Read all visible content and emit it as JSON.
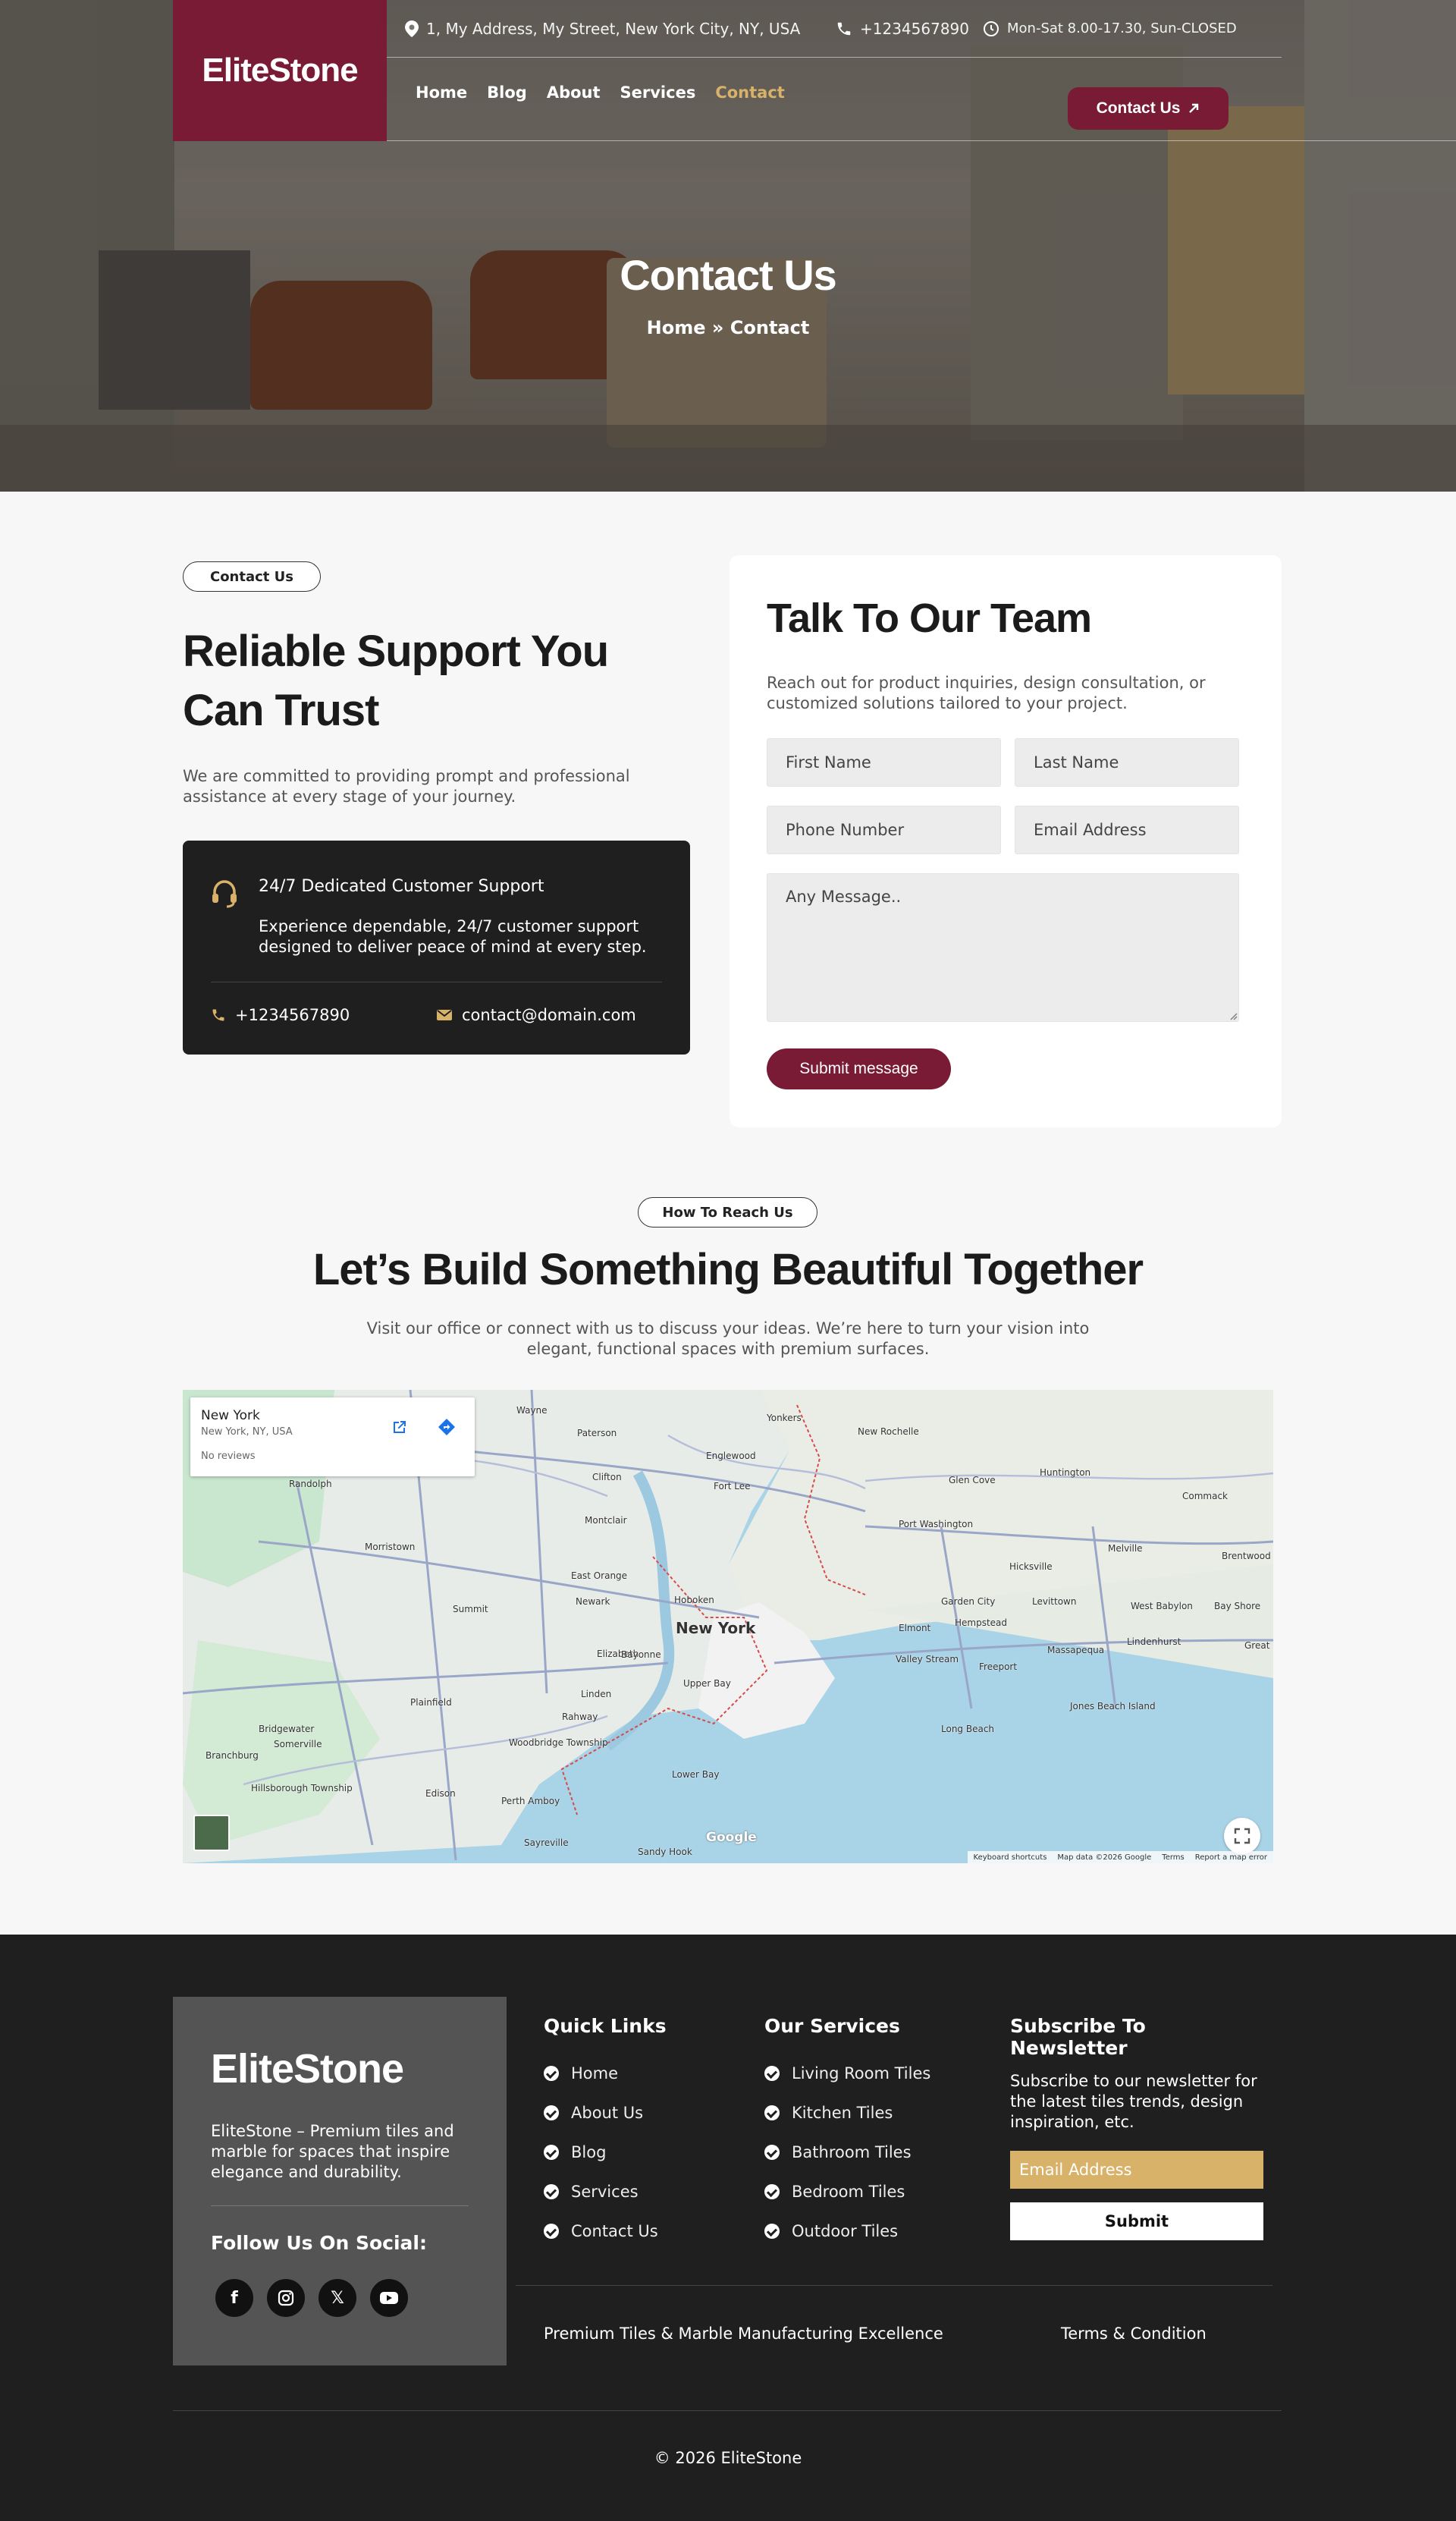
{
  "header": {
    "logo": "EliteStone",
    "address": "1, My Address, My Street, New York City, NY, USA",
    "phone": "+1234567890",
    "hours": "Mon-Sat 8.00-17.30, Sun-CLOSED",
    "nav": [
      "Home",
      "Blog",
      "About",
      "Services",
      "Contact"
    ],
    "cta": "Contact Us"
  },
  "hero": {
    "title": "Contact Us",
    "breadcrumb_home": "Home",
    "breadcrumb_sep": "»",
    "breadcrumb_current": "Contact"
  },
  "support": {
    "pill": "Contact Us",
    "title": "Reliable Support You Can Trust",
    "desc": "We are committed to providing prompt and professional assistance at every stage of your journey.",
    "card_title": "24/7 Dedicated Customer Support",
    "card_desc": "Experience dependable, 24/7 customer support designed to deliver peace of mind at every step.",
    "phone": "+1234567890",
    "email": "contact@domain.com"
  },
  "form": {
    "title": "Talk To Our Team",
    "desc": "Reach out for product inquiries, design consultation, or customized solutions tailored to your project.",
    "first_name": "First Name",
    "last_name": "Last Name",
    "phone": "Phone Number",
    "email": "Email Address",
    "message": "Any Message..",
    "submit": "Submit message"
  },
  "reach": {
    "pill": "How To Reach Us",
    "title": "Let’s Build Something Beautiful Together",
    "desc": "Visit our office or connect with us to discuss your ideas. We’re here to turn your vision into elegant, functional spaces with premium surfaces."
  },
  "map": {
    "place": "New York",
    "place_sub": "New York, NY, USA",
    "reviews": "No reviews",
    "labels": [
      "Wayne",
      "Paterson",
      "Yonkers",
      "New Rochelle",
      "Englewood",
      "Clifton",
      "Fort Lee",
      "Glen Cove",
      "Huntington",
      "Commack",
      "Randolph",
      "Montclair",
      "Port Washington",
      "Morristown",
      "East Orange",
      "Newark",
      "New York",
      "Hoboken",
      "Hicksville",
      "Melville",
      "Brentwood",
      "Summit",
      "Garden City",
      "Levittown",
      "West Babylon",
      "Bay Shore",
      "Elizabeth",
      "Bayonne",
      "Hempstead",
      "Elmont",
      "Lindenhurst",
      "Massapequa",
      "Valley Stream",
      "Freeport",
      "Plainfield",
      "Linden",
      "Rahway",
      "Jones Beach Island",
      "Long Beach",
      "Bridgewater",
      "Somerville",
      "Woodbridge Township",
      "Branchburg",
      "Edison",
      "Hillsborough Township",
      "Perth Amboy",
      "Sayreville",
      "Sandy Hook",
      "Upper Bay",
      "Lower Bay",
      "Great"
    ],
    "google": "Google",
    "footer_links": [
      "Keyboard shortcuts",
      "Map data ©2026 Google",
      "Terms",
      "Report a map error"
    ]
  },
  "footer": {
    "logo": "EliteStone",
    "desc": "EliteStone – Premium tiles and marble for spaces that inspire elegance and durability.",
    "follow": "Follow Us On Social:",
    "social_icons": [
      "facebook-icon",
      "instagram-icon",
      "x-icon",
      "youtube-icon"
    ],
    "quick_title": "Quick Links",
    "quick_links": [
      "Home",
      "About Us",
      "Blog",
      "Services",
      "Contact Us"
    ],
    "services_title": "Our Services",
    "services": [
      "Living Room Tiles",
      "Kitchen Tiles",
      "Bathroom Tiles",
      "Bedroom Tiles",
      "Outdoor Tiles"
    ],
    "newsletter_title": "Subscribe To Newsletter",
    "newsletter_desc": "Subscribe to our newsletter for the latest tiles trends, design inspiration, etc.",
    "newsletter_placeholder": "Email Address",
    "newsletter_submit": "Submit",
    "tagline": "Premium Tiles & Marble Manufacturing Excellence",
    "terms": "Terms & Condition",
    "copyright": "© 2026 EliteStone"
  },
  "colors": {
    "brand": "#7a1b36",
    "gold": "#d9b26a",
    "dark": "#1f1f1f"
  }
}
